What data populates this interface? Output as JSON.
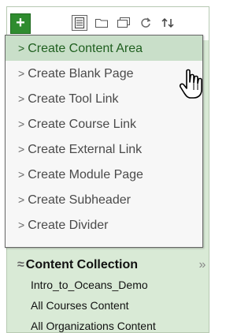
{
  "toolbar": {
    "add_label": "+",
    "icons": [
      "list-view-icon",
      "folder-icon",
      "window-icon",
      "refresh-icon",
      "sort-icon"
    ]
  },
  "menu": {
    "items": [
      {
        "label": "Create Content Area"
      },
      {
        "label": "Create Blank Page"
      },
      {
        "label": "Create Tool Link"
      },
      {
        "label": "Create Course Link"
      },
      {
        "label": "Create External Link"
      },
      {
        "label": "Create Module Page"
      },
      {
        "label": "Create Subheader"
      },
      {
        "label": "Create Divider"
      }
    ],
    "arrow": ">"
  },
  "content_collection": {
    "title": "Content Collection",
    "expand_glyph": "≈",
    "collapse_glyph": "»",
    "links": [
      "Intro_to_Oceans_Demo",
      "All Courses Content",
      "All Organizations Content"
    ]
  },
  "colors": {
    "accent_green": "#2f8c2f",
    "panel_bg": "#d9ead6",
    "hover_bg": "#c9dfc9"
  }
}
